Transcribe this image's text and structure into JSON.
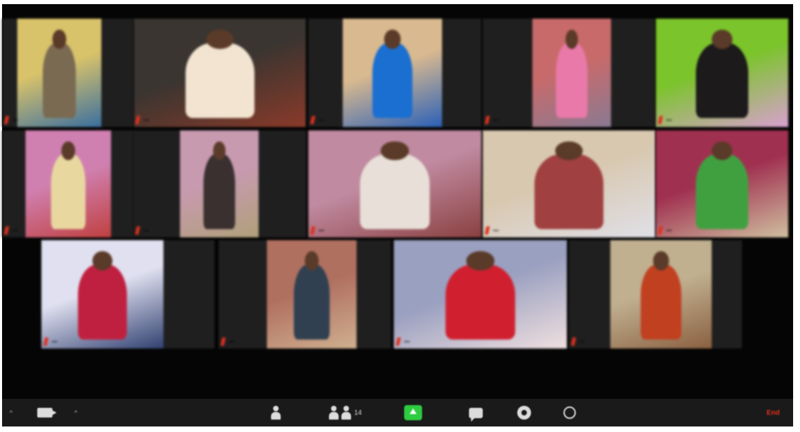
{
  "meeting": {
    "participants": [
      {
        "name": "",
        "colors": [
          "#d8c26a",
          "#7a6a52",
          "#3a6fa0"
        ]
      },
      {
        "name": "",
        "colors": [
          "#3a3530",
          "#f2e4d0",
          "#8a3a2a"
        ]
      },
      {
        "name": "",
        "colors": [
          "#d9b98f",
          "#1a6fd0",
          "#2a60b8"
        ]
      },
      {
        "name": "",
        "colors": [
          "#c96a6a",
          "#e879a8",
          "#8a7a92"
        ]
      },
      {
        "name": "",
        "colors": [
          "#7bc42b",
          "#1c1a1a",
          "#d9a0d0"
        ]
      },
      {
        "name": "",
        "colors": [
          "#d080b0",
          "#e8d8a0",
          "#c04040"
        ]
      },
      {
        "name": "",
        "colors": [
          "#c89ab0",
          "#3a3030",
          "#b0a07a"
        ]
      },
      {
        "name": "",
        "colors": [
          "#c08aa0",
          "#e8e0d8",
          "#8a4040"
        ]
      },
      {
        "name": "",
        "colors": [
          "#d8c8b0",
          "#a04040",
          "#e0e0e8"
        ]
      },
      {
        "name": "",
        "colors": [
          "#a03050",
          "#40a040",
          "#d0c0a0"
        ]
      },
      {
        "name": "",
        "colors": [
          "#e0e0f0",
          "#c02040",
          "#304070"
        ]
      },
      {
        "name": "",
        "colors": [
          "#b07060",
          "#304050",
          "#d0b090"
        ]
      },
      {
        "name": "",
        "colors": [
          "#9aa0c0",
          "#d02030",
          "#f0e0e0"
        ]
      },
      {
        "name": "",
        "colors": [
          "#c0b090",
          "#c04020",
          "#8a6040"
        ]
      }
    ]
  },
  "toolbar": {
    "participants_count": "14",
    "end_label": "End",
    "icons": {
      "mute": "microphone-icon",
      "video": "video-camera-icon",
      "security": "security-icon",
      "participants": "participants-icon",
      "share": "share-screen-icon",
      "chat": "chat-icon",
      "record": "record-icon",
      "reactions": "reactions-icon"
    }
  },
  "colors": {
    "muted_red": "#e0301e",
    "share_green": "#2ecc40",
    "tile_bg": "#1f1f1f",
    "window_bg": "#050505"
  }
}
